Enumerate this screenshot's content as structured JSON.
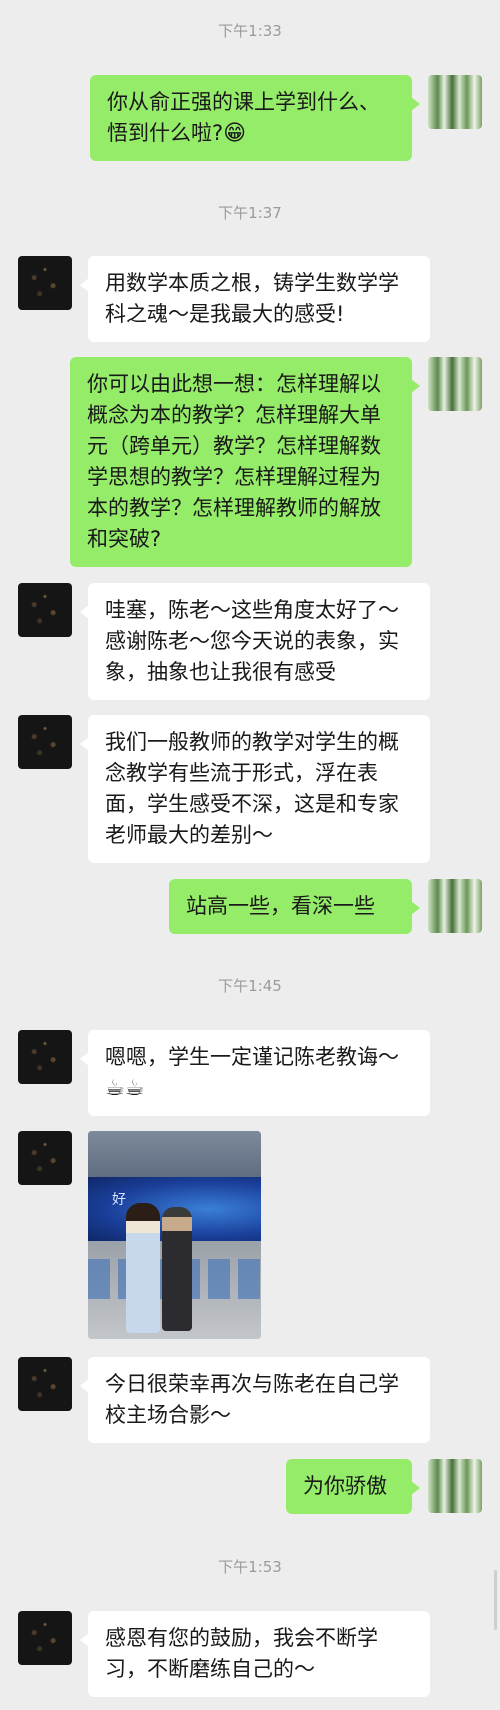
{
  "timestamps": [
    "下午1:33",
    "下午1:37",
    "下午1:45",
    "下午1:53"
  ],
  "messages": [
    {
      "sender": "me",
      "text": "你从俞正强的课上学到什么、悟到什么啦?",
      "emoji": "😁"
    },
    {
      "sender": "them",
      "text": "用数学本质之根，铸学生数学学科之魂～是我最大的感受!"
    },
    {
      "sender": "me",
      "text": "你可以由此想一想：怎样理解以概念为本的教学？怎样理解大单元（跨单元）教学？怎样理解数学思想的教学？怎样理解过程为本的教学？怎样理解教师的解放和突破?"
    },
    {
      "sender": "them",
      "text": "哇塞，陈老～这些角度太好了～感谢陈老～您今天说的表象，实象，抽象也让我很有感受"
    },
    {
      "sender": "them",
      "text": "我们一般教师的教学对学生的概念教学有些流于形式，浮在表面，学生感受不深，这是和专家老师最大的差别～"
    },
    {
      "sender": "me",
      "text": "站高一些，看深一些"
    },
    {
      "sender": "them",
      "text": "嗯嗯，学生一定谨记陈老教诲～",
      "emoji": "☕☕"
    },
    {
      "sender": "them",
      "type": "image",
      "image_text": "好"
    },
    {
      "sender": "them",
      "text": "今日很荣幸再次与陈老在自己学校主场合影～"
    },
    {
      "sender": "me",
      "text": "为你骄傲"
    },
    {
      "sender": "them",
      "text": "感恩有您的鼓励，我会不断学习，不断磨练自己的～"
    }
  ],
  "colors": {
    "background": "#ededed",
    "my_bubble": "#95ec69",
    "their_bubble": "#ffffff",
    "timestamp": "#9b9b9b"
  }
}
